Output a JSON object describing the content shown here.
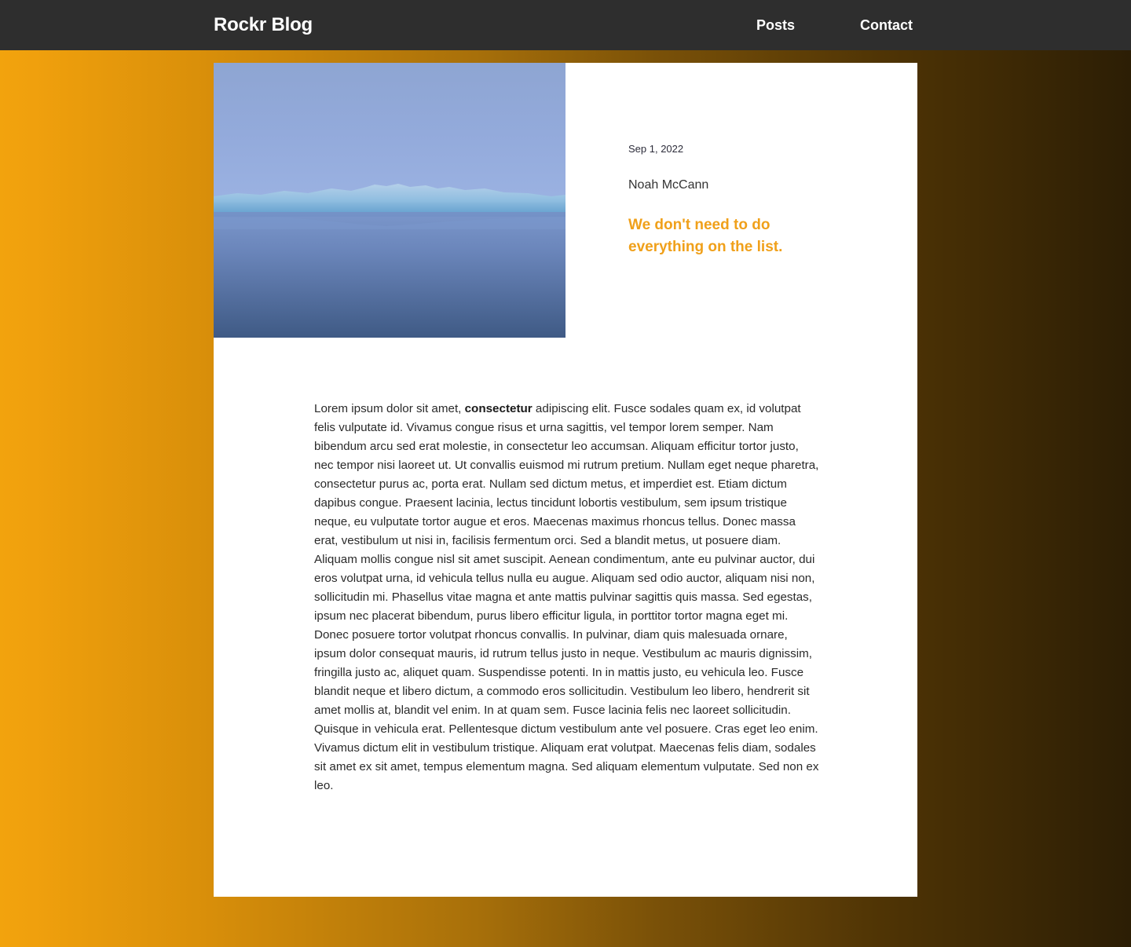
{
  "navbar": {
    "brand": "Rockr Blog",
    "links": [
      {
        "label": "Posts"
      },
      {
        "label": "Contact"
      }
    ]
  },
  "post": {
    "date": "Sep 1, 2022",
    "author": "Noah McCann",
    "title": "We don't need to do everything on the list.",
    "body_intro": "Lorem ipsum dolor sit amet, ",
    "body_bold": "consectetur",
    "body_rest": " adipiscing elit. Fusce sodales quam ex, id volutpat felis vulputate id. Vivamus congue risus et urna sagittis, vel tempor lorem semper. Nam bibendum arcu sed erat molestie, in consectetur leo accumsan. Aliquam efficitur tortor justo, nec tempor nisi laoreet ut. Ut convallis euismod mi rutrum pretium. Nullam eget neque pharetra, consectetur purus ac, porta erat. Nullam sed dictum metus, et imperdiet est. Etiam dictum dapibus congue. Praesent lacinia, lectus tincidunt lobortis vestibulum, sem ipsum tristique neque, eu vulputate tortor augue et eros. Maecenas maximus rhoncus tellus. Donec massa erat, vestibulum ut nisi in, facilisis fermentum orci. Sed a blandit metus, ut posuere diam. Aliquam mollis congue nisl sit amet suscipit. Aenean condimentum, ante eu pulvinar auctor, dui eros volutpat urna, id vehicula tellus nulla eu augue. Aliquam sed odio auctor, aliquam nisi non, sollicitudin mi. Phasellus vitae magna et ante mattis pulvinar sagittis quis massa. Sed egestas, ipsum nec placerat bibendum, purus libero efficitur ligula, in porttitor tortor magna eget mi. Donec posuere tortor volutpat rhoncus convallis. In pulvinar, diam quis malesuada ornare, ipsum dolor consequat mauris, id rutrum tellus justo in neque. Vestibulum ac mauris dignissim, fringilla justo ac, aliquet quam. Suspendisse potenti. In in mattis justo, eu vehicula leo. Fusce blandit neque et libero dictum, a commodo eros sollicitudin. Vestibulum leo libero, hendrerit sit amet mollis at, blandit vel enim. In at quam sem. Fusce lacinia felis nec laoreet sollicitudin. Quisque in vehicula erat. Pellentesque dictum vestibulum ante vel posuere. Cras eget leo enim. Vivamus dictum elit in vestibulum tristique. Aliquam erat volutpat. Maecenas felis diam, sodales sit amet ex sit amet, tempus elementum magna. Sed aliquam elementum vulputate. Sed non ex leo."
  },
  "colors": {
    "navbar_bg": "#2e2e2e",
    "accent": "#f0a01a",
    "gradient_start": "#f2a30d",
    "gradient_end": "#2c1e05",
    "card_bg": "#ffffff"
  }
}
